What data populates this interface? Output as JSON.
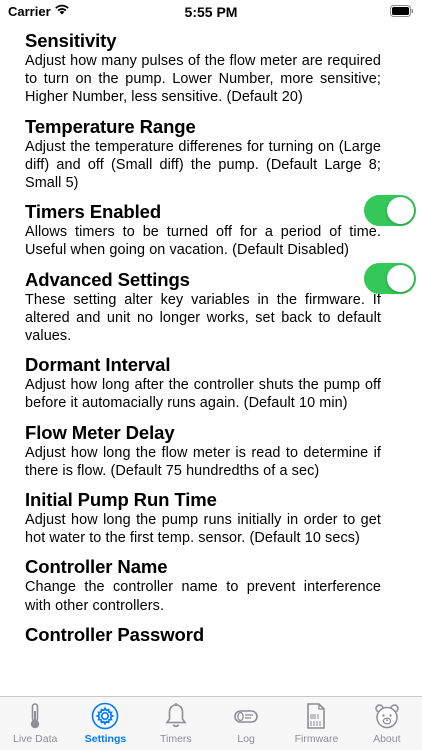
{
  "status": {
    "carrier": "Carrier",
    "time": "5:55 PM"
  },
  "sections": [
    {
      "title": "Sensitivity",
      "desc": "Adjust how many pulses of the flow meter are required to turn on the pump. Lower Number, more sensitive; Higher Number, less sensitive. (Default 20)"
    },
    {
      "title": "Temperature Range",
      "desc": "Adjust the temperature differenes for turning on (Large diff) and off (Small diff) the pump. (Default Large 8; Small 5)"
    },
    {
      "title": "Timers Enabled",
      "desc": "Allows timers to be turned off for a period of time. Useful when going on vacation. (Default Disabled)",
      "toggle_on": true
    },
    {
      "title": "Advanced Settings",
      "desc": "These setting alter key variables in the firmware. If altered and unit no longer works, set back to default values.",
      "toggle_on": true
    },
    {
      "title": "Dormant Interval",
      "desc": "Adjust how long after the controller shuts the pump off before it automacially runs again. (Default 10 min)"
    },
    {
      "title": "Flow Meter Delay",
      "desc": "Adjust how long the flow meter is read to determine if there is flow. (Default 75 hundredths of a sec)"
    },
    {
      "title": "Initial Pump Run Time",
      "desc": "Adjust how long the pump runs initially in order to get hot water to the first temp. sensor. (Default 10 secs)"
    },
    {
      "title": "Controller Name",
      "desc": "Change the controller name to prevent interference with other controllers."
    },
    {
      "title": "Controller Password",
      "desc": ""
    }
  ],
  "tabs": [
    {
      "label": "Live Data",
      "icon": "thermometer-icon"
    },
    {
      "label": "Settings",
      "icon": "gear-icon",
      "active": true
    },
    {
      "label": "Timers",
      "icon": "bell-icon"
    },
    {
      "label": "Log",
      "icon": "log-icon"
    },
    {
      "label": "Firmware",
      "icon": "firmware-file-icon"
    },
    {
      "label": "About",
      "icon": "bear-icon"
    }
  ],
  "colors": {
    "accent": "#007aff",
    "toggle_on": "#34c759",
    "tab_inactive": "#8e8e93"
  }
}
